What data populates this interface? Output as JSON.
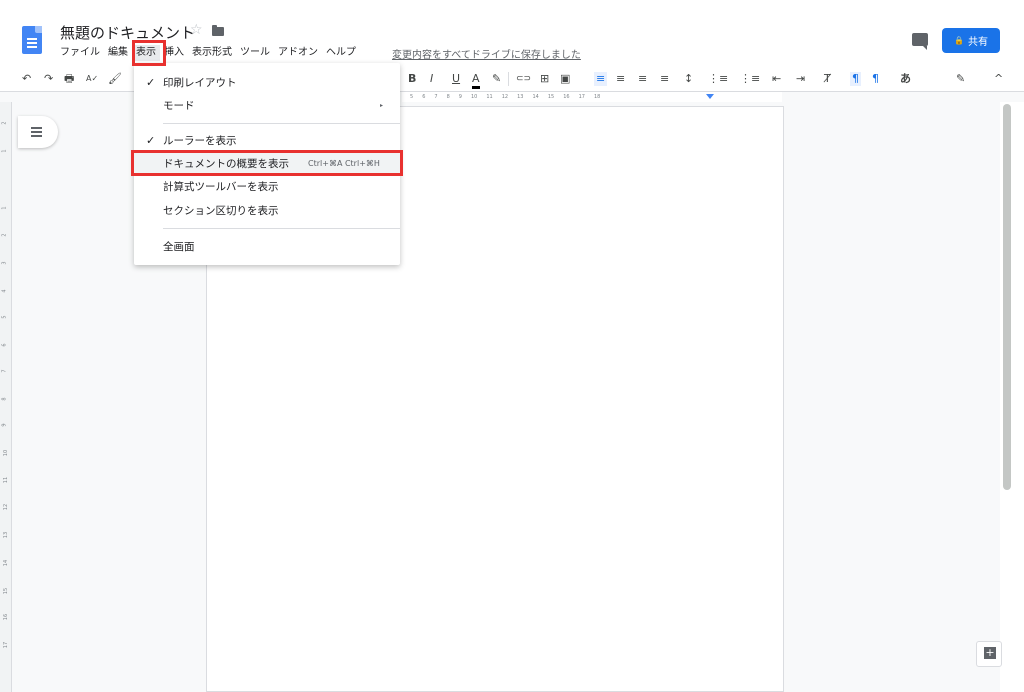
{
  "header": {
    "title": "無題のドキュメント",
    "star": "☆",
    "save_status": "変更内容をすべてドライブに保存しました",
    "share_label": "共有",
    "lock_glyph": "🔒"
  },
  "menubar": {
    "items": [
      "ファイル",
      "編集",
      "表示",
      "挿入",
      "表示形式",
      "ツール",
      "アドオン",
      "ヘルプ"
    ]
  },
  "toolbar": {
    "undo": "↶",
    "redo": "↷",
    "print": "🖶",
    "spell": "A✓",
    "paint": "🖌",
    "bold": "B",
    "italic": "I",
    "underline": "U",
    "text_color": "A",
    "highlight": "✎",
    "link": "⊂⊃",
    "comment": "⊞",
    "image": "▣",
    "align_left": "≡",
    "align_center": "≡",
    "align_right": "≡",
    "align_justify": "≡",
    "line_spacing": "↕",
    "numbered_list": "⋮≡",
    "bulleted_list": "⋮≡",
    "indent_dec": "⇤",
    "indent_inc": "⇥",
    "clear_format": "Ⱦ",
    "ltr": "¶",
    "rtl": "¶",
    "input_tools": "あ",
    "edit_mode": "✎",
    "collapse": "^"
  },
  "ruler": {
    "labels": [
      "5",
      "6",
      "7",
      "8",
      "9",
      "10",
      "11",
      "12",
      "13",
      "14",
      "15",
      "16",
      "17",
      "18"
    ]
  },
  "vruler": {
    "labels": [
      "2",
      "1",
      "1",
      "2",
      "3",
      "4",
      "5",
      "6",
      "7",
      "8",
      "9",
      "10",
      "11",
      "12",
      "13",
      "14",
      "15",
      "16",
      "17"
    ]
  },
  "view_menu": {
    "items": [
      {
        "check": "✓",
        "label": "印刷レイアウト"
      },
      {
        "label": "モード",
        "arrow": "▸"
      },
      {
        "check": "✓",
        "label": "ルーラーを表示"
      },
      {
        "label": "ドキュメントの概要を表示",
        "shortcut": "Ctrl+⌘A Ctrl+⌘H"
      },
      {
        "label": "計算式ツールバーを表示"
      },
      {
        "label": "セクション区切りを表示"
      },
      {
        "label": "全画面"
      }
    ]
  },
  "colors": {
    "accent": "#1a73e8",
    "highlight_box": "#e8312f"
  }
}
